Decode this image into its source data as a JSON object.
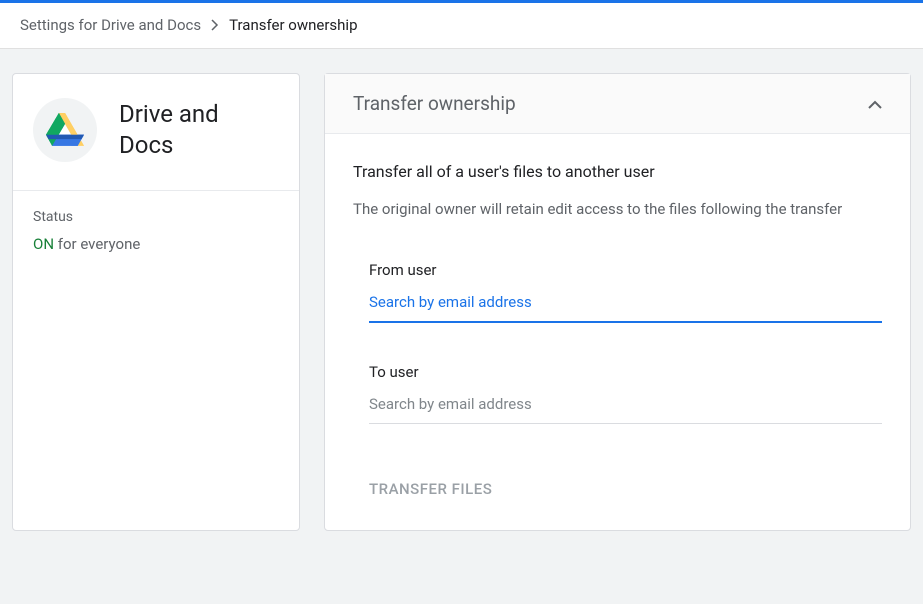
{
  "breadcrumb": {
    "parent": "Settings for Drive and Docs",
    "current": "Transfer ownership"
  },
  "sidebar": {
    "app_name": "Drive and Docs",
    "status_label": "Status",
    "status_on": "ON",
    "status_text": " for everyone"
  },
  "main": {
    "header_title": "Transfer ownership",
    "section_title": "Transfer all of a user's files to another user",
    "section_desc": "The original owner will retain edit access to the files following the transfer",
    "from_label": "From user",
    "from_placeholder": "Search by email address",
    "from_value": "",
    "to_label": "To user",
    "to_placeholder": "Search by email address",
    "to_value": "",
    "button_label": "TRANSFER FILES"
  }
}
